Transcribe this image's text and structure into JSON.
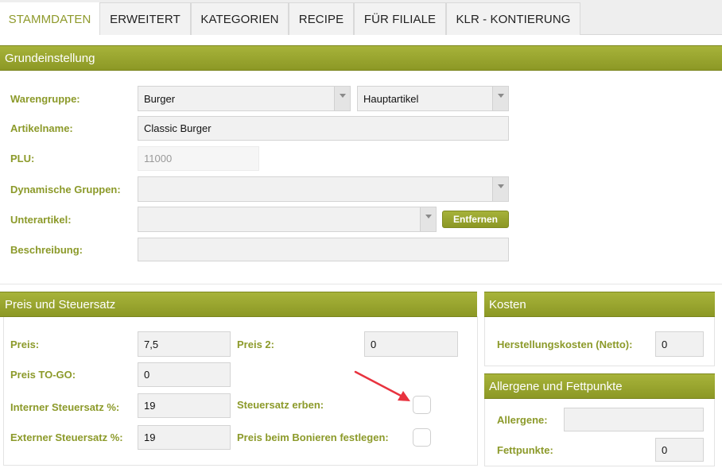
{
  "tabs": [
    "STAMMDATEN",
    "ERWEITERT",
    "KATEGORIEN",
    "RECIPE",
    "FÜR FILIALE",
    "KLR - KONTIERUNG"
  ],
  "grundeinstellung": {
    "title": "Grundeinstellung",
    "warengruppe_label": "Warengruppe:",
    "warengruppe_value": "Burger",
    "warengruppe_type": "Hauptartikel",
    "artikelname_label": "Artikelname:",
    "artikelname_value": "Classic Burger",
    "plu_label": "PLU:",
    "plu_placeholder": "11000",
    "dyn_gruppen_label": "Dynamische Gruppen:",
    "unterartikel_label": "Unterartikel:",
    "entfernen_label": "Entfernen",
    "beschreibung_label": "Beschreibung:"
  },
  "preis": {
    "title": "Preis und Steuersatz",
    "preis_label": "Preis:",
    "preis_value": "7,5",
    "preis2_label": "Preis 2:",
    "preis2_value": "0",
    "togo_label": "Preis TO-GO:",
    "togo_value": "0",
    "intern_label": "Interner Steuersatz %:",
    "intern_value": "19",
    "erben_label": "Steuersatz erben:",
    "extern_label": "Externer Steuersatz %:",
    "extern_value": "19",
    "bonieren_label": "Preis beim Bonieren festlegen:"
  },
  "kosten": {
    "title": "Kosten",
    "herstellung_label": "Herstellungskosten (Netto):",
    "herstellung_value": "0"
  },
  "allergene": {
    "title": "Allergene und Fettpunkte",
    "allergene_label": "Allergene:",
    "fett_label": "Fettpunkte:",
    "fett_value": "0"
  },
  "colors": {
    "accent": "#8c9a2a",
    "header": "#9aa62f",
    "arrow": "#e8333f"
  }
}
